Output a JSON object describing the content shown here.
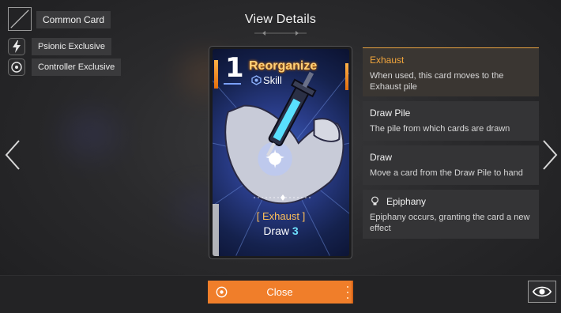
{
  "header": {
    "rarity_label": "Common Card",
    "title": "View Details"
  },
  "exclusives": [
    {
      "label": "Psionic Exclusive",
      "icon": "lightning-icon"
    },
    {
      "label": "Controller Exclusive",
      "icon": "target-icon"
    }
  ],
  "card": {
    "cost": "1",
    "name": "Reorganize",
    "type": "Skill",
    "keyword_line": "[ Exhaust ]",
    "effect_text": "Draw",
    "effect_value": "3"
  },
  "keywords": [
    {
      "title": "Exhaust",
      "description": "When used, this card moves to the Exhaust pile",
      "active": true
    },
    {
      "title": "Draw Pile",
      "description": "The pile from which cards are drawn",
      "active": false
    },
    {
      "title": "Draw",
      "description": "Move a card from the Draw Pile to hand",
      "active": false
    },
    {
      "title": "Epiphany",
      "description": "Epiphany occurs, granting the card a new effect",
      "active": false,
      "icon": "lightbulb-icon"
    }
  ],
  "footer": {
    "close_label": "Close"
  },
  "colors": {
    "accent": "#f07e2a",
    "keyword_highlight": "#f1a53c",
    "card_name": "#ffd07a",
    "draw_value": "#6ee0ff"
  }
}
